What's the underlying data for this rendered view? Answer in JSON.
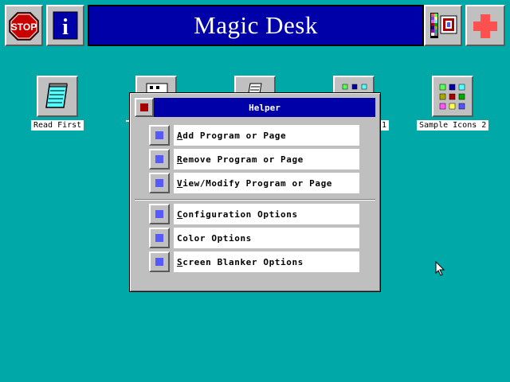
{
  "app": {
    "title": "Magic Desk"
  },
  "toolbar": {
    "stop_label": "STOP",
    "info_label": "i"
  },
  "desktop": {
    "icons": [
      {
        "label": "Read First"
      },
      {
        "label": ""
      },
      {
        "label": ""
      },
      {
        "label": "1"
      },
      {
        "label": "Sample Icons 2"
      }
    ]
  },
  "dialog": {
    "title": "Helper",
    "items": [
      {
        "accel": "A",
        "rest": "dd Program or Page"
      },
      {
        "accel": "R",
        "rest": "emove Program or Page"
      },
      {
        "accel": "V",
        "rest": "iew/Modify Program or Page"
      },
      {
        "accel": "C",
        "rest": "onfiguration Options"
      },
      {
        "accel": "C",
        "rest": "olor Options"
      },
      {
        "accel": "S",
        "rest": "creen Blanker Options"
      }
    ]
  },
  "colors": {
    "desktop": "#00a8a8",
    "title_bar": "#0000a8",
    "stop_red": "#c80000",
    "button_square": "#5858ff",
    "close_square": "#a80000"
  }
}
